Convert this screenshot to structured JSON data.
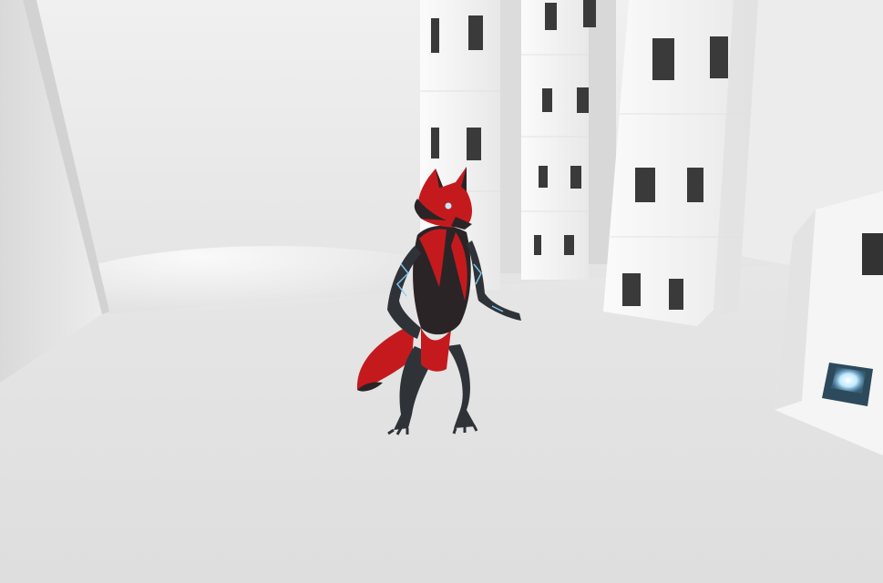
{
  "scene": {
    "colors": {
      "wall_light": "#f2f2f2",
      "wall_shadow": "#c9c9c9",
      "floor": "#e4e4e4",
      "pillar": "#f4f4f4",
      "pillar_side": "#d6d6d6",
      "window": "#3a3a3a",
      "fox_red": "#c41a1e",
      "fox_dark": "#2b2426",
      "fox_limb": "#2f3338",
      "glow": "#7fd3ff"
    },
    "icons": {
      "avatar": "fox-avatar-icon",
      "light": "glowing-window-icon"
    }
  }
}
